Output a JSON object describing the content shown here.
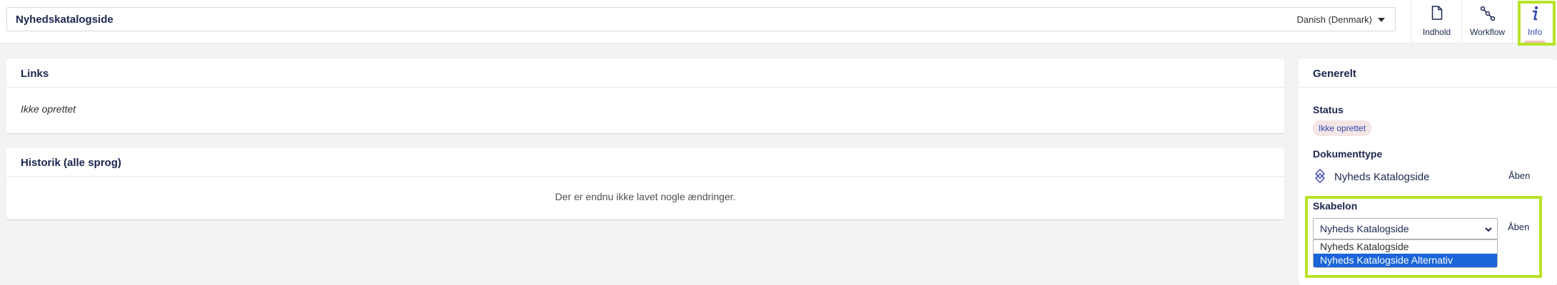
{
  "header": {
    "name": "Nyhedskatalogside",
    "language": "Danish (Denmark)",
    "apps": [
      {
        "label": "Indhold",
        "icon": "document-icon"
      },
      {
        "label": "Workflow",
        "icon": "workflow-icon"
      },
      {
        "label": "Info",
        "icon": "info-icon",
        "active": true
      }
    ]
  },
  "links": {
    "title": "Links",
    "empty_text": "Ikke oprettet"
  },
  "history": {
    "title": "Historik (alle sprog)",
    "empty_text": "Der er endnu ikke lavet nogle ændringer."
  },
  "general": {
    "title": "Generelt",
    "status_label": "Status",
    "status_value": "Ikke oprettet",
    "doctype_label": "Dokumenttype",
    "doctype_name": "Nyheds Katalogside",
    "open_label": "Åben",
    "template_label": "Skabelon",
    "template_selected": "Nyheds Katalogside",
    "template_options": [
      "Nyheds Katalogside",
      "Nyheds Katalogside Alternativ"
    ],
    "template_highlighted_option": "Nyheds Katalogside Alternativ"
  },
  "colors": {
    "highlight": "#b8e327",
    "accent": "#3544b1",
    "selected_option": "#1a65d7",
    "badge_bg": "#f3e6e5"
  }
}
